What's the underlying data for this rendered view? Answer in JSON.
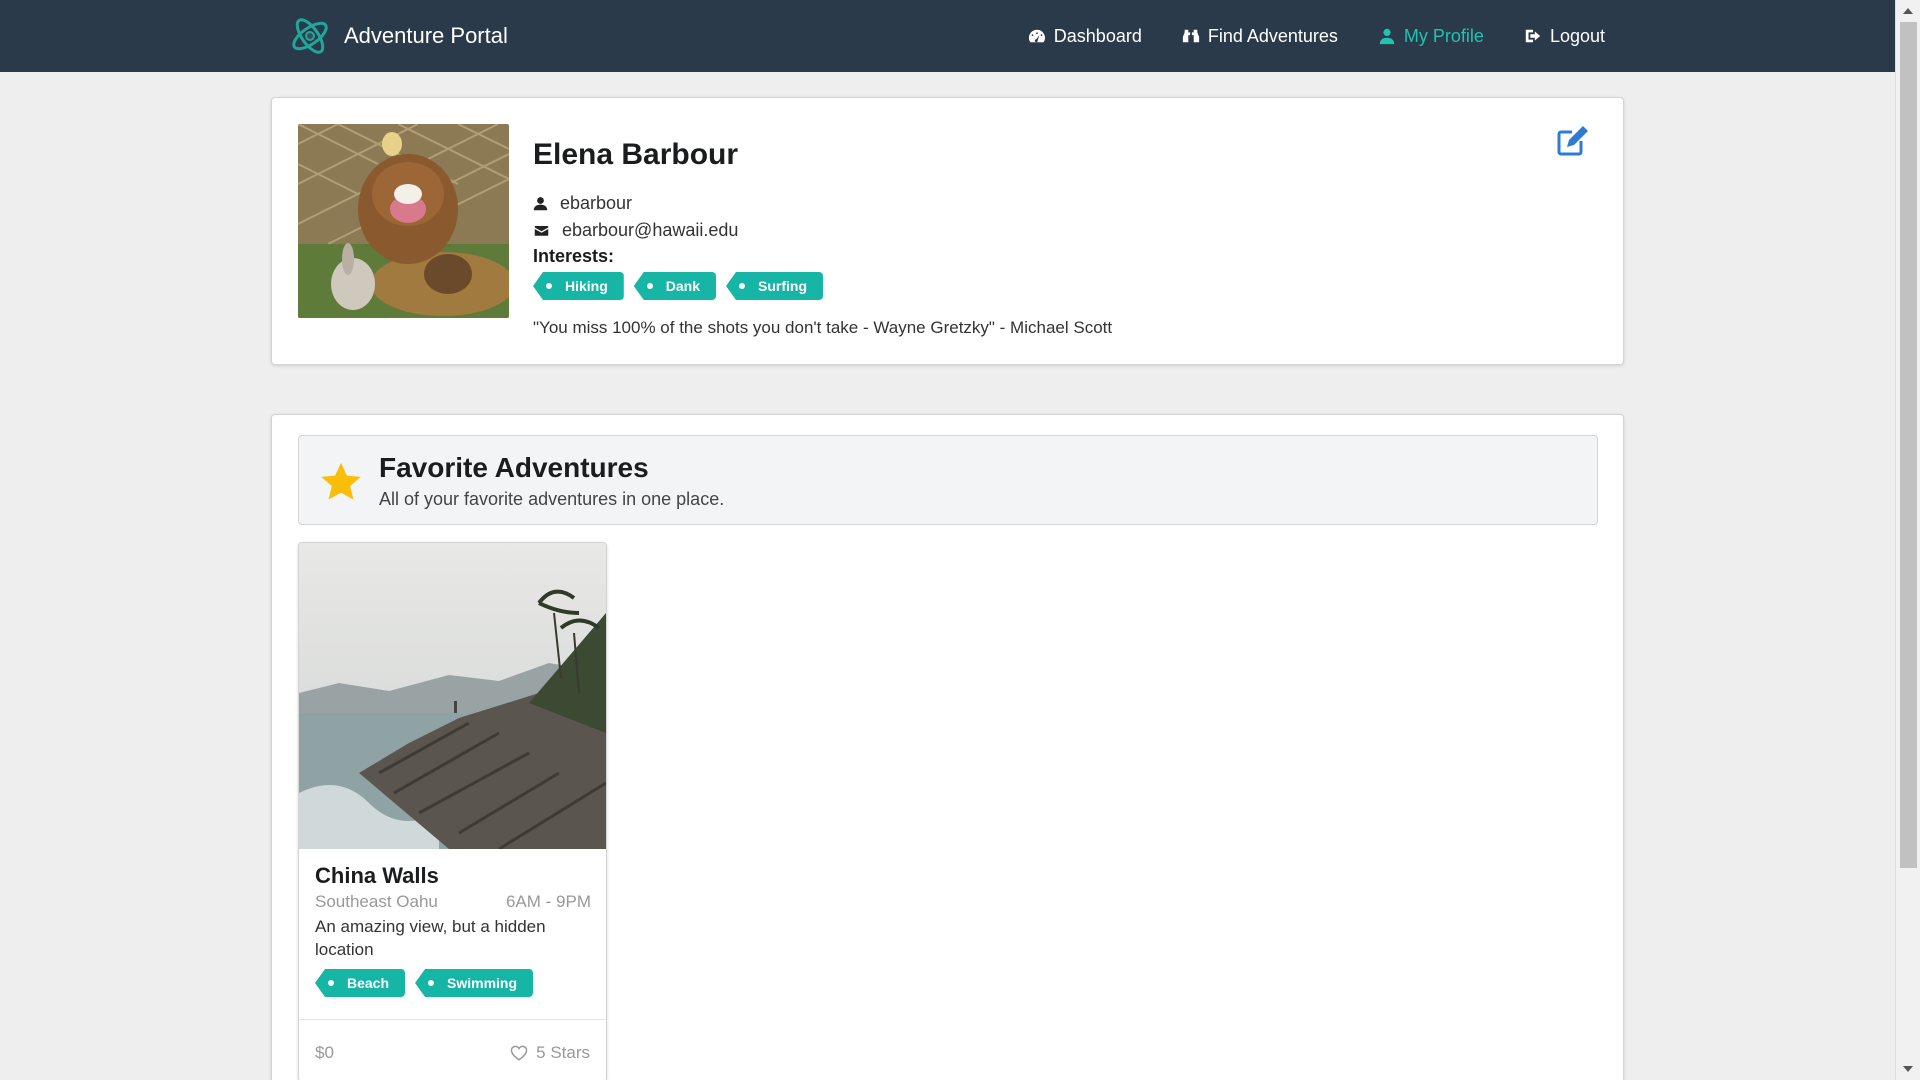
{
  "nav": {
    "brand": "Adventure Portal",
    "items": [
      {
        "label": "Dashboard",
        "icon": "dashboard-icon",
        "active": false
      },
      {
        "label": "Find Adventures",
        "icon": "binoculars-icon",
        "active": false
      },
      {
        "label": "My Profile",
        "icon": "user-icon",
        "active": true
      },
      {
        "label": "Logout",
        "icon": "logout-icon",
        "active": false
      }
    ]
  },
  "profile": {
    "name": "Elena Barbour",
    "username": "ebarbour",
    "email": "ebarbour@hawaii.edu",
    "interests_label": "Interests:",
    "interests": [
      "Hiking",
      "Dank",
      "Surfing"
    ],
    "quote": "\"You miss 100% of the shots you don't take - Wayne Gretzky\" - Michael Scott"
  },
  "favorites": {
    "title": "Favorite Adventures",
    "subtitle": "All of your favorite adventures in one place.",
    "cards": [
      {
        "title": "China Walls",
        "location": "Southeast Oahu",
        "hours": "6AM - 9PM",
        "description": "An amazing view, but a hidden location",
        "tags": [
          "Beach",
          "Swimming"
        ],
        "price": "$0",
        "rating": "5 Stars"
      }
    ]
  },
  "colors": {
    "navbar": "#2b3a4a",
    "accent": "#21c2b1",
    "tag": "#17b5a6",
    "star": "#fbbd08",
    "edit": "#2e7bcf"
  }
}
